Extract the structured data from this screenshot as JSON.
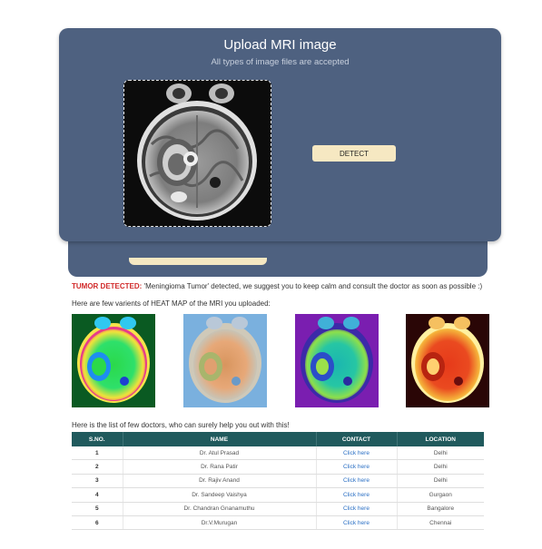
{
  "upload": {
    "title": "Upload MRI image",
    "subtitle": "All types of image files are accepted",
    "detect_label": "DETECT"
  },
  "result": {
    "label": "TUMOR DETECTED:",
    "message": " 'Meningioma Tumor' detected, we suggest you to keep calm and consult the doctor as soon as possible :)"
  },
  "heatmaps": {
    "intro": "Here are few varients of HEAT MAP of the MRI you uploaded:",
    "variants": [
      "jet-colormap",
      "pastel-colormap",
      "plasma-colormap",
      "hot-colormap"
    ]
  },
  "doctors": {
    "intro": "Here is the list of few doctors, who can surely help you out with this!",
    "headers": [
      "S.NO.",
      "NAME",
      "CONTACT",
      "LOCATION"
    ],
    "rows": [
      {
        "sno": "1",
        "name": "Dr. Atul Prasad",
        "contact": "Click here",
        "location": "Delhi"
      },
      {
        "sno": "2",
        "name": "Dr. Rana Patir",
        "contact": "Click here",
        "location": "Delhi"
      },
      {
        "sno": "3",
        "name": "Dr. Rajiv Anand",
        "contact": "Click here",
        "location": "Delhi"
      },
      {
        "sno": "4",
        "name": "Dr. Sandeep Vaishya",
        "contact": "Click here",
        "location": "Gurgaon"
      },
      {
        "sno": "5",
        "name": "Dr. Chandran Gnanamuthu",
        "contact": "Click here",
        "location": "Bangalore"
      },
      {
        "sno": "6",
        "name": "Dr.V.Murugan",
        "contact": "Click here",
        "location": "Chennai"
      }
    ]
  },
  "colors": {
    "card_bg": "#4e6180",
    "button_bg": "#f6e8c2",
    "alert_red": "#d12a2a",
    "table_header": "#205a5d",
    "link_blue": "#2a6fc4"
  }
}
